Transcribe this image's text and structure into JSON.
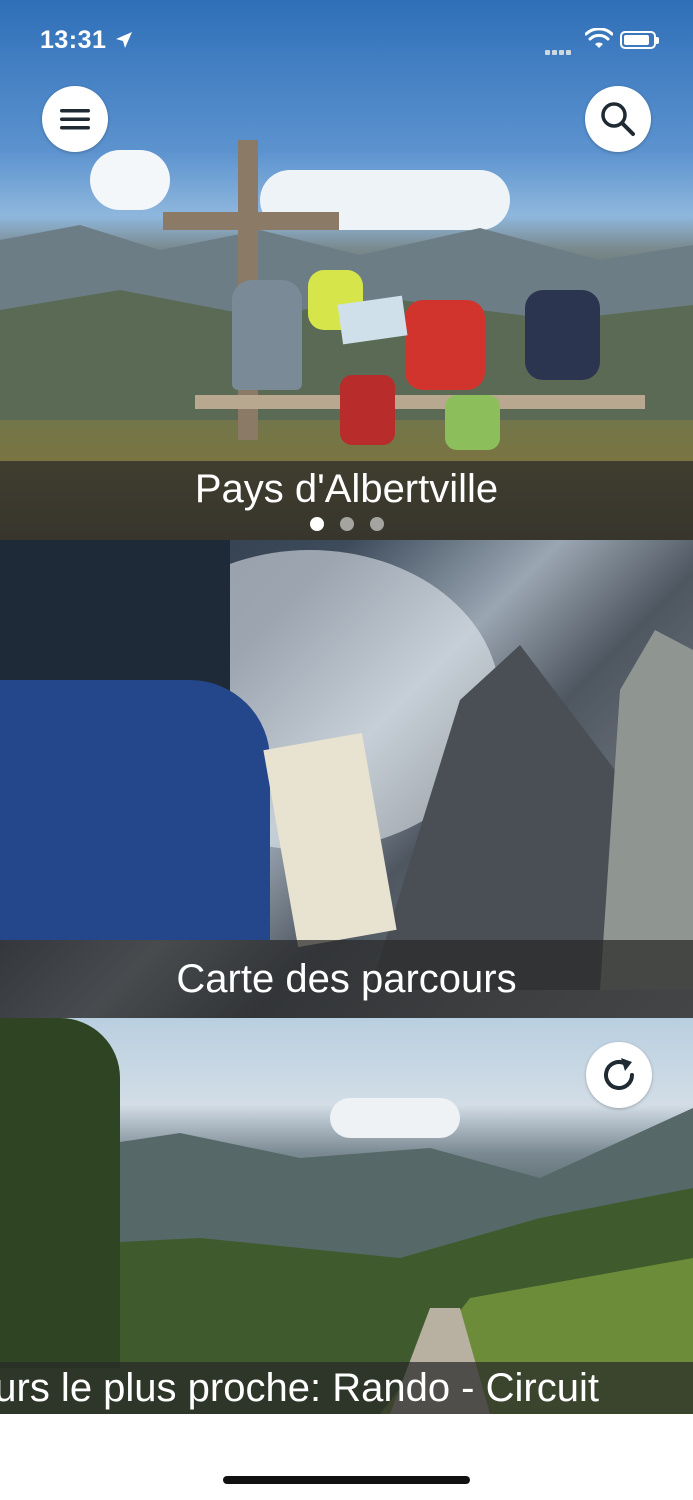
{
  "status_bar": {
    "time": "13:31"
  },
  "header": {
    "menu_icon": "hamburger-menu-icon",
    "search_icon": "search-icon"
  },
  "cards": [
    {
      "title": "Pays d'Albertville"
    },
    {
      "title": "Carte des parcours"
    },
    {
      "title": "ours le plus proche:  Rando - Circuit"
    }
  ],
  "carousel": {
    "pages": 3,
    "active_page": 1
  },
  "colors": {
    "overlay": "#282828",
    "icon": "#1f2a33"
  }
}
